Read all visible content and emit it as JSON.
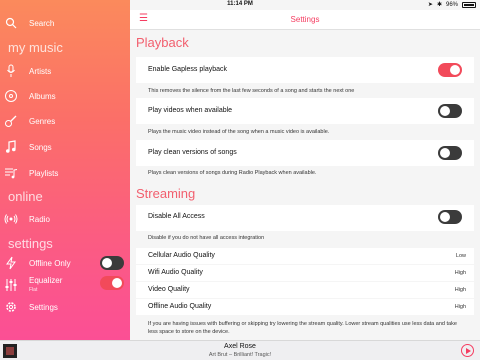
{
  "status": {
    "carrier": "",
    "time": "11:14 PM",
    "battery": "96%"
  },
  "sidebar": {
    "search": "Search",
    "sections": {
      "my_music": "my music",
      "online": "online",
      "settings": "settings"
    },
    "items": {
      "artists": "Artists",
      "albums": "Albums",
      "genres": "Genres",
      "songs": "Songs",
      "playlists": "Playlists",
      "radio": "Radio",
      "offline_only": "Offline Only",
      "equalizer": "Equalizer",
      "equalizer_sub": "Flat",
      "settings": "Settings"
    },
    "toggles": {
      "offline_only": false,
      "equalizer": true
    }
  },
  "nav": {
    "title": "Settings"
  },
  "settings": {
    "playback": {
      "header": "Playback",
      "gapless": {
        "label": "Enable Gapless playback",
        "on": true,
        "desc": "This removes the silence from the last few seconds of a song and starts the next one"
      },
      "videos": {
        "label": "Play videos when available",
        "on": false,
        "desc": "Plays the music video instead of the song when a music video is available."
      },
      "clean": {
        "label": "Play clean versions of songs",
        "on": false,
        "desc": "Plays clean versions of songs during Radio Playback when available."
      }
    },
    "streaming": {
      "header": "Streaming",
      "disable_all": {
        "label": "Disable All Access",
        "on": false,
        "desc": "Disable if you do not have all access integration"
      },
      "cellular": {
        "label": "Cellular Audio Quality",
        "value": "Low"
      },
      "wifi": {
        "label": "Wifi Audio Quality",
        "value": "High"
      },
      "video": {
        "label": "Video Quality",
        "value": "High"
      },
      "offline": {
        "label": "Offline Audio Quality",
        "value": "High"
      },
      "footer": "If you are having issues with buffering or skipping try lowering the stream quality. Lower stream qualities use less data and take less space to store on the device."
    }
  },
  "player": {
    "song": "Axel Rose",
    "artist": "Art Brut – Brilliant! Tragic!"
  },
  "colors": {
    "accent": "#f53d61",
    "toggle_on": "#f24a5a",
    "toggle_off": "#3b3b3b"
  }
}
